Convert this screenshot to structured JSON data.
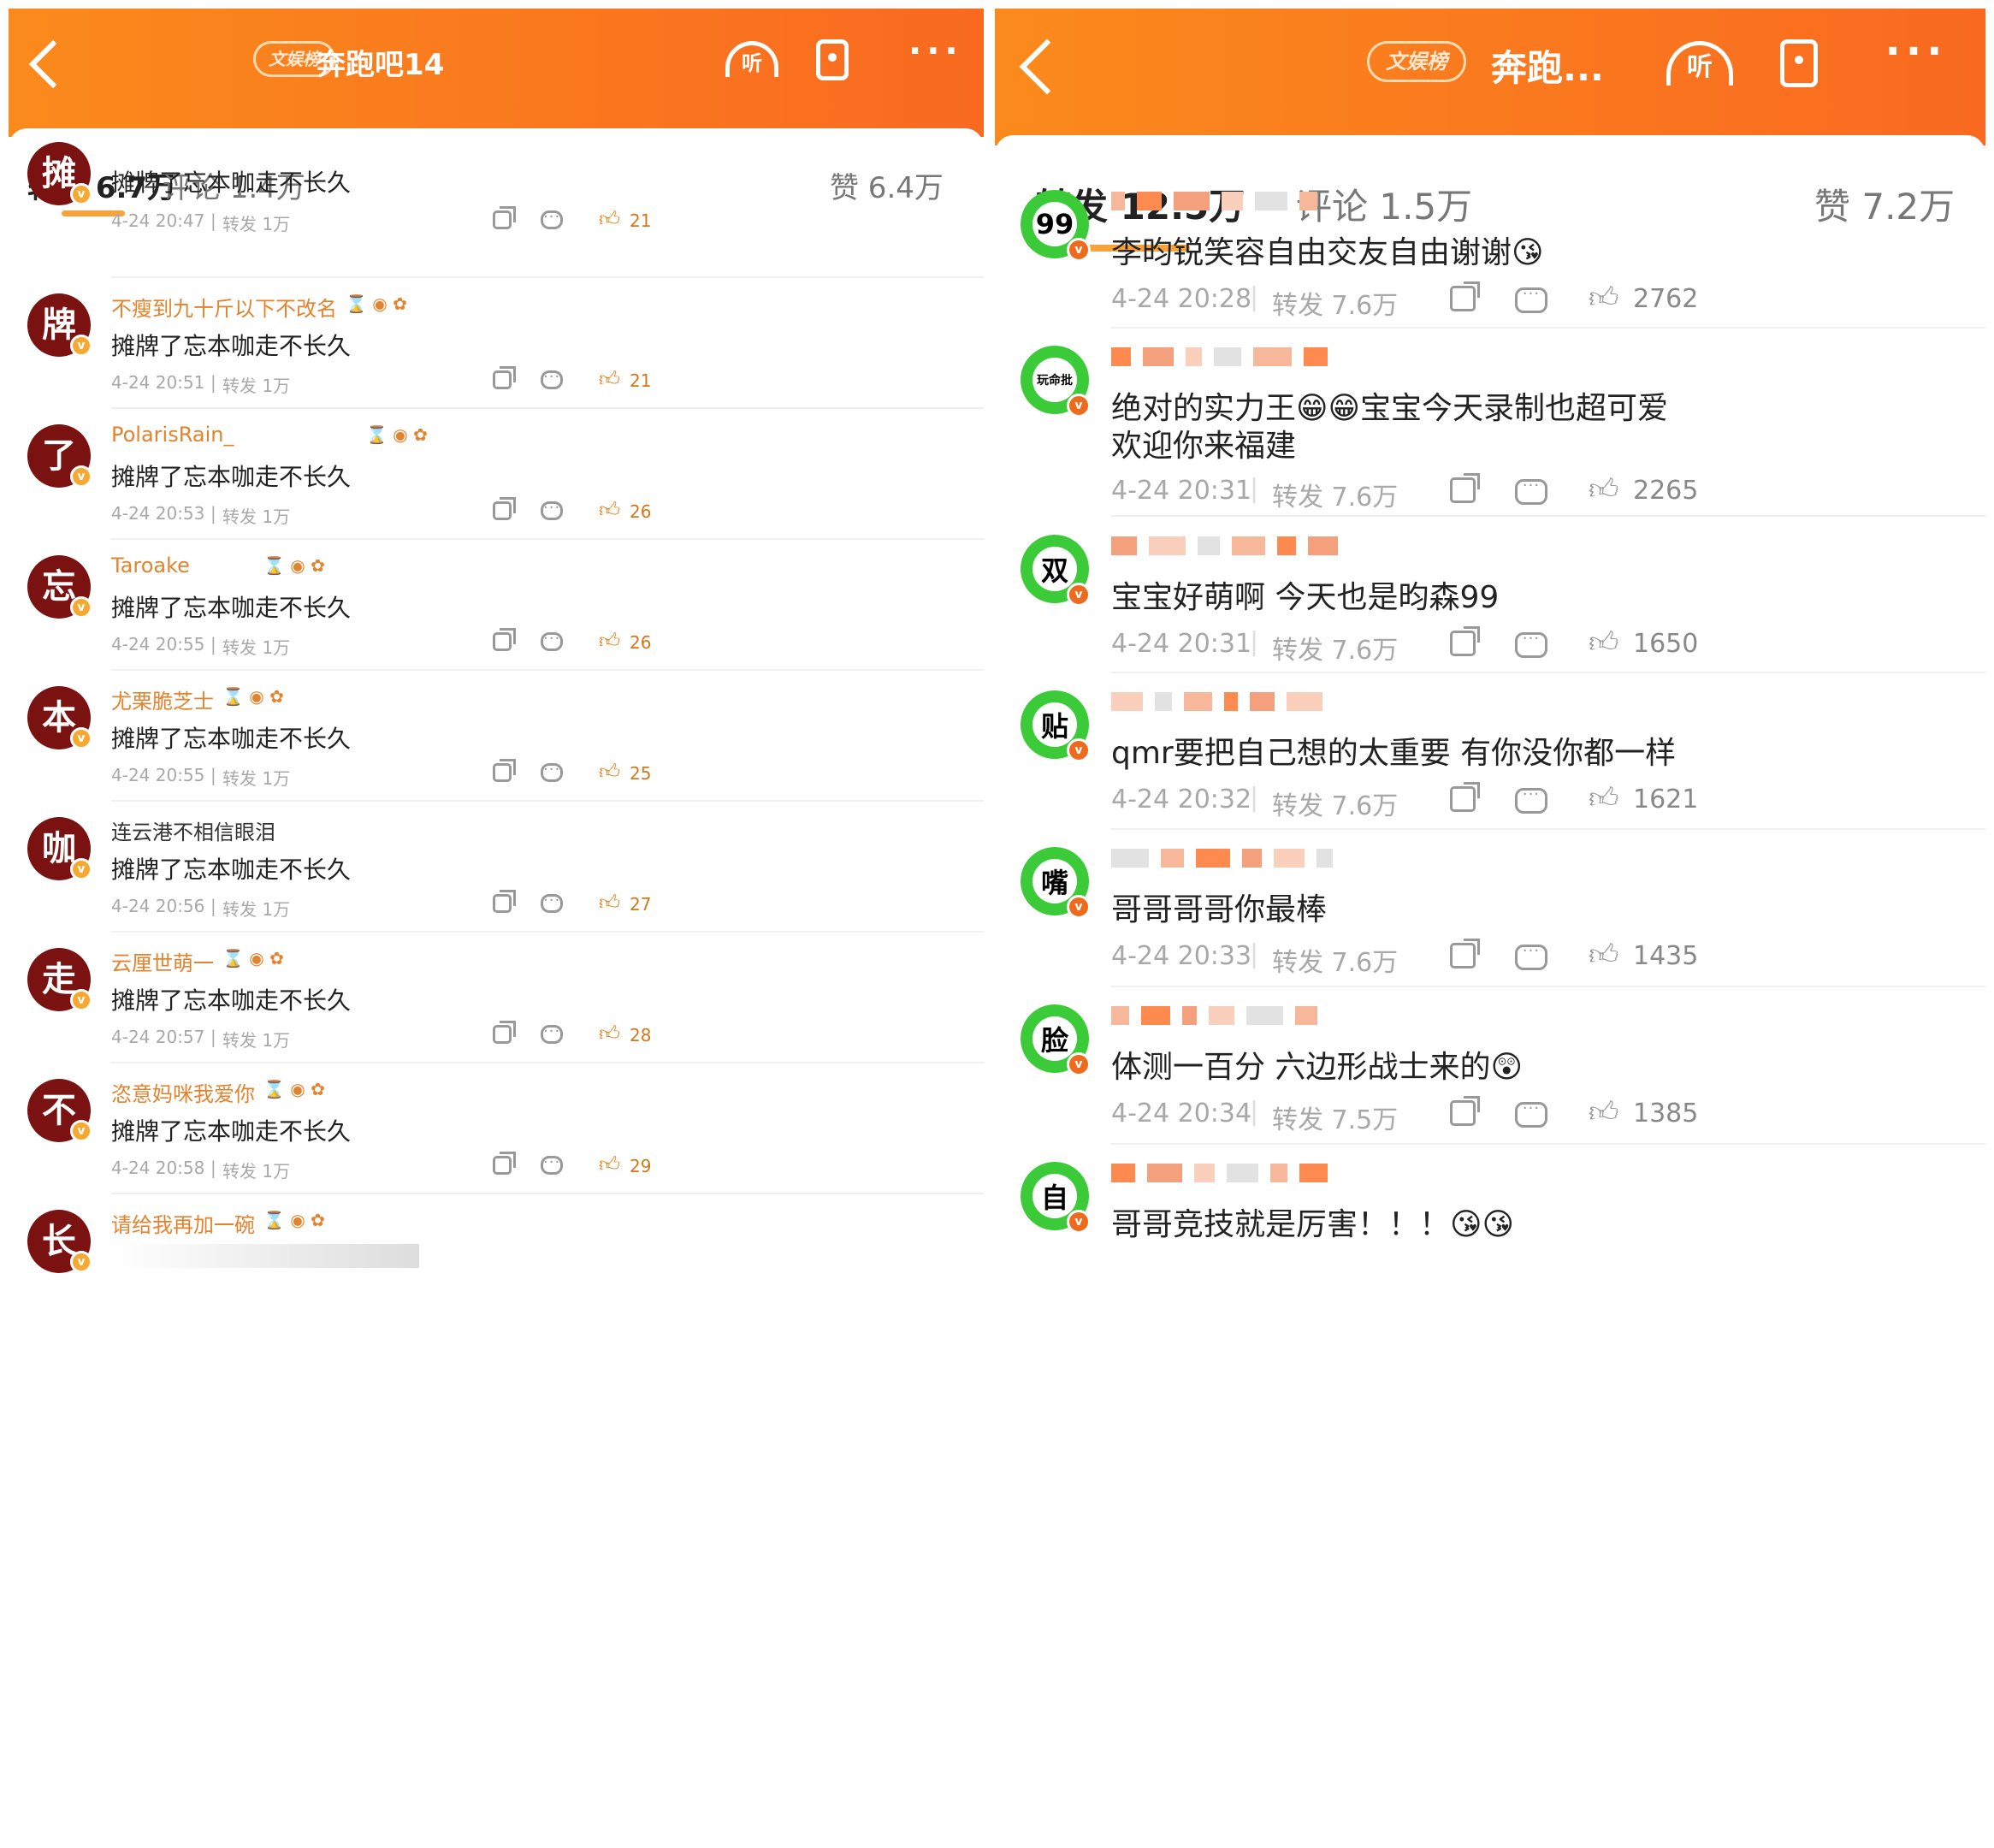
{
  "left": {
    "header": {
      "badge": "文娱榜",
      "title": "奔跑吧14",
      "listen": "听"
    },
    "tabs": {
      "repost": "转发 6.7万",
      "comment": "评论 1.4万",
      "like": "赞 6.4万"
    },
    "comments": [
      {
        "avatar": "摊",
        "name": "",
        "text": "摊牌了忘本咖走不长久",
        "time": "4-24 20:47",
        "reposts": "转发 1万",
        "likes": "21",
        "liked": true
      },
      {
        "avatar": "牌",
        "name": "不瘦到九十斤以下不改名",
        "text": "摊牌了忘本咖走不长久",
        "time": "4-24 20:51",
        "reposts": "转发 1万",
        "likes": "21",
        "liked": true
      },
      {
        "avatar": "了",
        "name": "PolarisRain_",
        "text": "摊牌了忘本咖走不长久",
        "time": "4-24 20:53",
        "reposts": "转发 1万",
        "likes": "26",
        "liked": true
      },
      {
        "avatar": "忘",
        "name": "Taroake",
        "text": "摊牌了忘本咖走不长久",
        "time": "4-24 20:55",
        "reposts": "转发 1万",
        "likes": "26",
        "liked": true
      },
      {
        "avatar": "本",
        "name": "尤栗脆芝士",
        "text": "摊牌了忘本咖走不长久",
        "time": "4-24 20:55",
        "reposts": "转发 1万",
        "likes": "25",
        "liked": true
      },
      {
        "avatar": "咖",
        "name": "连云港不相信眼泪",
        "text": "摊牌了忘本咖走不长久",
        "time": "4-24 20:56",
        "reposts": "转发 1万",
        "likes": "27",
        "liked": true
      },
      {
        "avatar": "走",
        "name": "云厘世萌一",
        "text": "摊牌了忘本咖走不长久",
        "time": "4-24 20:57",
        "reposts": "转发 1万",
        "likes": "28",
        "liked": true
      },
      {
        "avatar": "不",
        "name": "恣意妈咪我爱你",
        "text": "摊牌了忘本咖走不长久",
        "time": "4-24 20:58",
        "reposts": "转发 1万",
        "likes": "29",
        "liked": true
      },
      {
        "avatar": "长",
        "name": "请给我再加一碗",
        "text": "",
        "time": "",
        "reposts": "",
        "likes": "",
        "liked": true
      }
    ]
  },
  "right": {
    "header": {
      "badge": "文娱榜",
      "title": "奔跑...",
      "listen": "听"
    },
    "tabs": {
      "repost": "转发 12.5万",
      "comment": "评论 1.5万",
      "like": "赞 7.2万"
    },
    "comments": [
      {
        "avatar": "99",
        "text": "李昀锐笑容自由交友自由谢谢😘",
        "text2": "",
        "time": "4-24 20:28",
        "reposts": "转发 7.6万",
        "likes": "2762"
      },
      {
        "avatar": "玩命批",
        "text": "绝对的实力王😁😁宝宝今天录制也超可爱",
        "text2": "欢迎你来福建",
        "time": "4-24 20:31",
        "reposts": "转发 7.6万",
        "likes": "2265"
      },
      {
        "avatar": "双",
        "text": "宝宝好萌啊 今天也是昀森99",
        "text2": "",
        "time": "4-24 20:31",
        "reposts": "转发 7.6万",
        "likes": "1650"
      },
      {
        "avatar": "贴",
        "text": "qmr要把自己想的太重要 有你没你都一样",
        "text2": "",
        "time": "4-24 20:32",
        "reposts": "转发 7.6万",
        "likes": "1621"
      },
      {
        "avatar": "嘴",
        "text": "哥哥哥哥你最棒",
        "text2": "",
        "time": "4-24 20:33",
        "reposts": "转发 7.6万",
        "likes": "1435"
      },
      {
        "avatar": "脸",
        "text": "体测一百分 六边形战士来的😲",
        "text2": "",
        "time": "4-24 20:34",
        "reposts": "转发 7.5万",
        "likes": "1385"
      },
      {
        "avatar": "自",
        "text": "哥哥竞技就是厉害！！！😘😘",
        "text2": "",
        "time": "",
        "reposts": "",
        "likes": ""
      }
    ]
  },
  "colors": {
    "header_start": "#fb8a1c",
    "header_end": "#f96a20",
    "accent": "#f8a23a",
    "like_on": "#e3831f",
    "username": "#e2832e",
    "avatar_left": "#7b1212",
    "avatar_right": "#3bcb38"
  }
}
